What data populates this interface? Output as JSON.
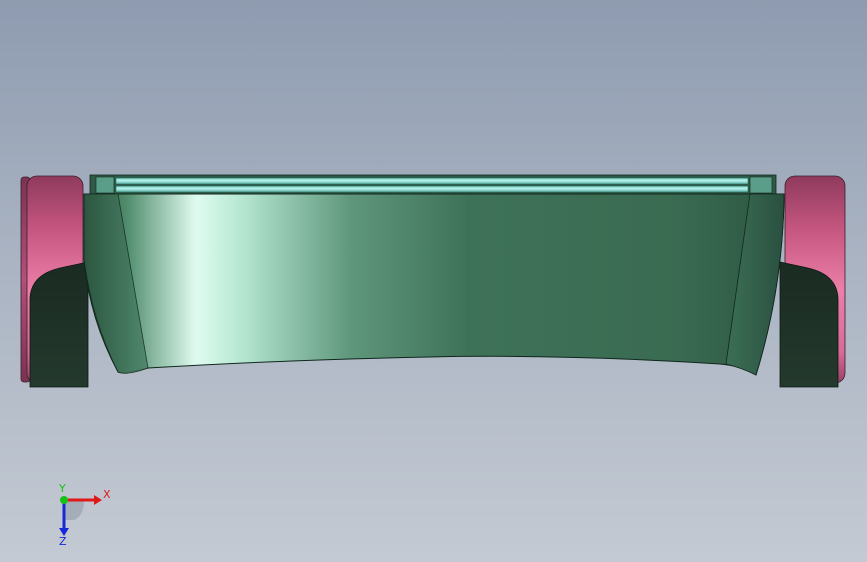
{
  "viewport": {
    "background_top": "#8e9bb0",
    "background_bottom": "#c4cad3"
  },
  "model": {
    "body_color": "#3e7258",
    "top_strip_color": "#a8ece2",
    "wheel_color": "#d96b96",
    "bracket_color": "#1f3328"
  },
  "triad": {
    "x_label": "X",
    "y_label": "Y",
    "z_label": "Z",
    "x_color": "#e01818",
    "y_color": "#18c018",
    "z_color": "#1828d8"
  }
}
